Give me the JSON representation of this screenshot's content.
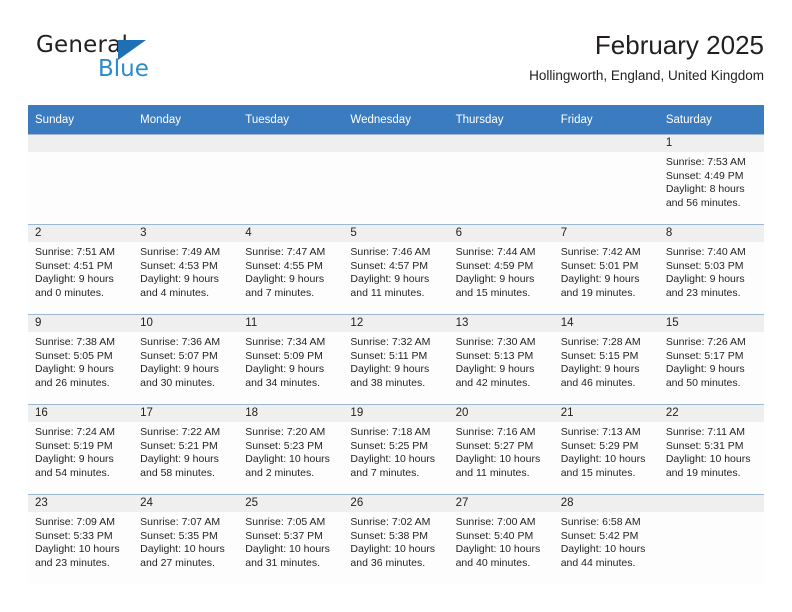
{
  "brand": {
    "name_top": "General",
    "name_bottom": "Blue",
    "triangle_color": "#1f6fb5",
    "blue_color": "#2b8ccc"
  },
  "header": {
    "title": "February 2025",
    "location": "Hollingworth, England, United Kingdom"
  },
  "theme": {
    "header_bg": "#3b7cc0",
    "header_text": "#ffffff",
    "daynum_bg": "#efefef",
    "cell_bg": "#fdfdfd",
    "rule_color": "#9fb8d2",
    "text_color": "#231f20"
  },
  "columns": [
    "Sunday",
    "Monday",
    "Tuesday",
    "Wednesday",
    "Thursday",
    "Friday",
    "Saturday"
  ],
  "weeks": [
    [
      {
        "day": "",
        "lines": []
      },
      {
        "day": "",
        "lines": []
      },
      {
        "day": "",
        "lines": []
      },
      {
        "day": "",
        "lines": []
      },
      {
        "day": "",
        "lines": []
      },
      {
        "day": "",
        "lines": []
      },
      {
        "day": "1",
        "lines": [
          "Sunrise: 7:53 AM",
          "Sunset: 4:49 PM",
          "Daylight: 8 hours",
          "and 56 minutes."
        ]
      }
    ],
    [
      {
        "day": "2",
        "lines": [
          "Sunrise: 7:51 AM",
          "Sunset: 4:51 PM",
          "Daylight: 9 hours",
          "and 0 minutes."
        ]
      },
      {
        "day": "3",
        "lines": [
          "Sunrise: 7:49 AM",
          "Sunset: 4:53 PM",
          "Daylight: 9 hours",
          "and 4 minutes."
        ]
      },
      {
        "day": "4",
        "lines": [
          "Sunrise: 7:47 AM",
          "Sunset: 4:55 PM",
          "Daylight: 9 hours",
          "and 7 minutes."
        ]
      },
      {
        "day": "5",
        "lines": [
          "Sunrise: 7:46 AM",
          "Sunset: 4:57 PM",
          "Daylight: 9 hours",
          "and 11 minutes."
        ]
      },
      {
        "day": "6",
        "lines": [
          "Sunrise: 7:44 AM",
          "Sunset: 4:59 PM",
          "Daylight: 9 hours",
          "and 15 minutes."
        ]
      },
      {
        "day": "7",
        "lines": [
          "Sunrise: 7:42 AM",
          "Sunset: 5:01 PM",
          "Daylight: 9 hours",
          "and 19 minutes."
        ]
      },
      {
        "day": "8",
        "lines": [
          "Sunrise: 7:40 AM",
          "Sunset: 5:03 PM",
          "Daylight: 9 hours",
          "and 23 minutes."
        ]
      }
    ],
    [
      {
        "day": "9",
        "lines": [
          "Sunrise: 7:38 AM",
          "Sunset: 5:05 PM",
          "Daylight: 9 hours",
          "and 26 minutes."
        ]
      },
      {
        "day": "10",
        "lines": [
          "Sunrise: 7:36 AM",
          "Sunset: 5:07 PM",
          "Daylight: 9 hours",
          "and 30 minutes."
        ]
      },
      {
        "day": "11",
        "lines": [
          "Sunrise: 7:34 AM",
          "Sunset: 5:09 PM",
          "Daylight: 9 hours",
          "and 34 minutes."
        ]
      },
      {
        "day": "12",
        "lines": [
          "Sunrise: 7:32 AM",
          "Sunset: 5:11 PM",
          "Daylight: 9 hours",
          "and 38 minutes."
        ]
      },
      {
        "day": "13",
        "lines": [
          "Sunrise: 7:30 AM",
          "Sunset: 5:13 PM",
          "Daylight: 9 hours",
          "and 42 minutes."
        ]
      },
      {
        "day": "14",
        "lines": [
          "Sunrise: 7:28 AM",
          "Sunset: 5:15 PM",
          "Daylight: 9 hours",
          "and 46 minutes."
        ]
      },
      {
        "day": "15",
        "lines": [
          "Sunrise: 7:26 AM",
          "Sunset: 5:17 PM",
          "Daylight: 9 hours",
          "and 50 minutes."
        ]
      }
    ],
    [
      {
        "day": "16",
        "lines": [
          "Sunrise: 7:24 AM",
          "Sunset: 5:19 PM",
          "Daylight: 9 hours",
          "and 54 minutes."
        ]
      },
      {
        "day": "17",
        "lines": [
          "Sunrise: 7:22 AM",
          "Sunset: 5:21 PM",
          "Daylight: 9 hours",
          "and 58 minutes."
        ]
      },
      {
        "day": "18",
        "lines": [
          "Sunrise: 7:20 AM",
          "Sunset: 5:23 PM",
          "Daylight: 10 hours",
          "and 2 minutes."
        ]
      },
      {
        "day": "19",
        "lines": [
          "Sunrise: 7:18 AM",
          "Sunset: 5:25 PM",
          "Daylight: 10 hours",
          "and 7 minutes."
        ]
      },
      {
        "day": "20",
        "lines": [
          "Sunrise: 7:16 AM",
          "Sunset: 5:27 PM",
          "Daylight: 10 hours",
          "and 11 minutes."
        ]
      },
      {
        "day": "21",
        "lines": [
          "Sunrise: 7:13 AM",
          "Sunset: 5:29 PM",
          "Daylight: 10 hours",
          "and 15 minutes."
        ]
      },
      {
        "day": "22",
        "lines": [
          "Sunrise: 7:11 AM",
          "Sunset: 5:31 PM",
          "Daylight: 10 hours",
          "and 19 minutes."
        ]
      }
    ],
    [
      {
        "day": "23",
        "lines": [
          "Sunrise: 7:09 AM",
          "Sunset: 5:33 PM",
          "Daylight: 10 hours",
          "and 23 minutes."
        ]
      },
      {
        "day": "24",
        "lines": [
          "Sunrise: 7:07 AM",
          "Sunset: 5:35 PM",
          "Daylight: 10 hours",
          "and 27 minutes."
        ]
      },
      {
        "day": "25",
        "lines": [
          "Sunrise: 7:05 AM",
          "Sunset: 5:37 PM",
          "Daylight: 10 hours",
          "and 31 minutes."
        ]
      },
      {
        "day": "26",
        "lines": [
          "Sunrise: 7:02 AM",
          "Sunset: 5:38 PM",
          "Daylight: 10 hours",
          "and 36 minutes."
        ]
      },
      {
        "day": "27",
        "lines": [
          "Sunrise: 7:00 AM",
          "Sunset: 5:40 PM",
          "Daylight: 10 hours",
          "and 40 minutes."
        ]
      },
      {
        "day": "28",
        "lines": [
          "Sunrise: 6:58 AM",
          "Sunset: 5:42 PM",
          "Daylight: 10 hours",
          "and 44 minutes."
        ]
      },
      {
        "day": "",
        "lines": []
      }
    ]
  ]
}
